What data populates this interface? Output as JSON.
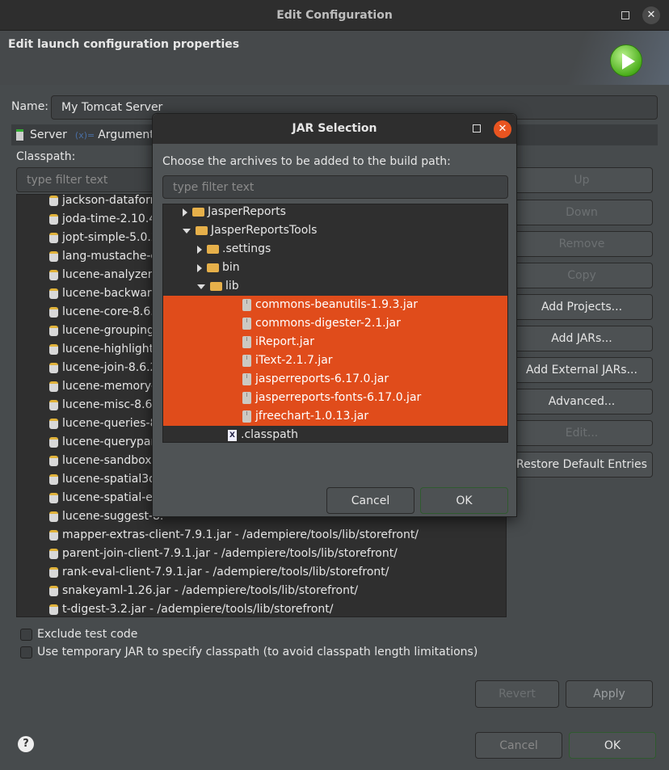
{
  "window": {
    "title": "Edit Configuration",
    "header": "Edit launch configuration properties"
  },
  "name_field": {
    "label": "Name:",
    "value": "My Tomcat Server"
  },
  "tabs": [
    {
      "label": "Server"
    },
    {
      "label": "Arguments"
    }
  ],
  "classpath": {
    "label": "Classpath:",
    "filter_placeholder": "type filter text",
    "items": [
      "jackson-dataforr",
      "joda-time-2.10.4.",
      "jopt-simple-5.0.2",
      "lang-mustache-cl",
      "lucene-analyzers-",
      "lucene-backward",
      "lucene-core-8.6.2",
      "lucene-grouping-",
      "lucene-highlighte",
      "lucene-join-8.6.2.",
      "lucene-memory-8",
      "lucene-misc-8.6.2",
      "lucene-queries-8.",
      "lucene-querypars",
      "lucene-sandbox-8",
      "lucene-spatial3d-",
      "lucene-spatial-ex",
      "lucene-suggest-8.",
      "mapper-extras-client-7.9.1.jar - /adempiere/tools/lib/storefront/",
      "parent-join-client-7.9.1.jar - /adempiere/tools/lib/storefront/",
      "rank-eval-client-7.9.1.jar - /adempiere/tools/lib/storefront/",
      "snakeyaml-1.26.jar - /adempiere/tools/lib/storefront/",
      "t-digest-3.2.jar - /adempiere/tools/lib/storefront/"
    ]
  },
  "side_buttons": [
    {
      "label": "Up",
      "enabled": false
    },
    {
      "label": "Down",
      "enabled": false
    },
    {
      "label": "Remove",
      "enabled": false
    },
    {
      "label": "Copy",
      "enabled": false
    },
    {
      "label": "Add Projects...",
      "enabled": true
    },
    {
      "label": "Add JARs...",
      "enabled": true
    },
    {
      "label": "Add External JARs...",
      "enabled": true
    },
    {
      "label": "Advanced...",
      "enabled": true
    },
    {
      "label": "Edit...",
      "enabled": false
    },
    {
      "label": "Restore Default Entries",
      "enabled": true
    }
  ],
  "options": [
    {
      "label": "Exclude test code",
      "checked": false
    },
    {
      "label": "Use temporary JAR to specify classpath (to avoid classpath length limitations)",
      "checked": false
    }
  ],
  "revert_label": "Revert",
  "apply_label": "Apply",
  "cancel_label": "Cancel",
  "ok_label": "OK",
  "jar_dialog": {
    "title": "JAR Selection",
    "prompt": "Choose the archives to be added to the build path:",
    "filter_placeholder": "type filter text",
    "tree": [
      {
        "label": "JasperReports",
        "type": "folder",
        "expanded": false,
        "depth": 0
      },
      {
        "label": "JasperReportsTools",
        "type": "folder",
        "expanded": true,
        "depth": 0
      },
      {
        "label": ".settings",
        "type": "folder",
        "expanded": false,
        "depth": 1
      },
      {
        "label": "bin",
        "type": "folder",
        "expanded": false,
        "depth": 1
      },
      {
        "label": "lib",
        "type": "folder",
        "expanded": true,
        "depth": 1
      },
      {
        "label": "commons-beanutils-1.9.3.jar",
        "type": "jar",
        "selected": true,
        "depth": 2
      },
      {
        "label": "commons-digester-2.1.jar",
        "type": "jar",
        "selected": true,
        "depth": 2
      },
      {
        "label": "iReport.jar",
        "type": "jar",
        "selected": true,
        "depth": 2
      },
      {
        "label": "iText-2.1.7.jar",
        "type": "jar",
        "selected": true,
        "depth": 2
      },
      {
        "label": "jasperreports-6.17.0.jar",
        "type": "jar",
        "selected": true,
        "depth": 2
      },
      {
        "label": "jasperreports-fonts-6.17.0.jar",
        "type": "jar",
        "selected": true,
        "depth": 2
      },
      {
        "label": "jfreechart-1.0.13.jar",
        "type": "jar",
        "selected": true,
        "depth": 2
      },
      {
        "label": ".classpath",
        "type": "file",
        "depth": 1
      }
    ],
    "cancel_label": "Cancel",
    "ok_label": "OK"
  },
  "colors": {
    "selection": "#e04c1b",
    "close_button": "#e95420"
  }
}
